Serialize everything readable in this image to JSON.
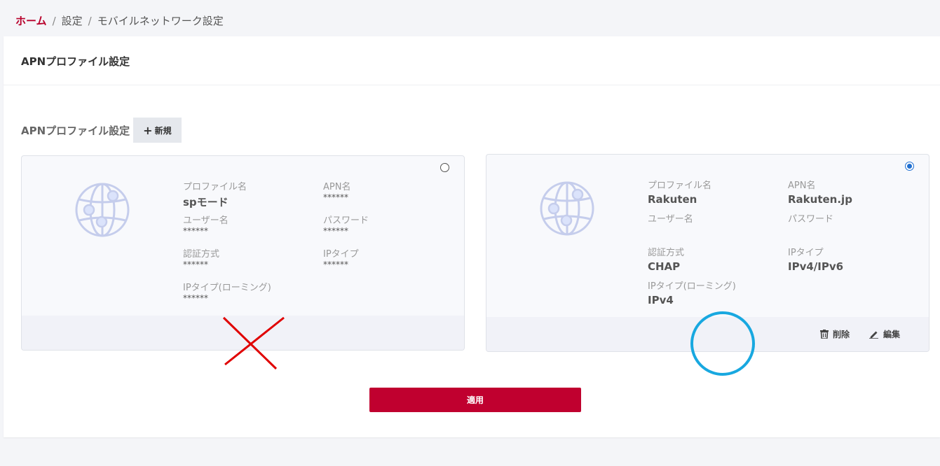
{
  "breadcrumb": {
    "home": "ホーム",
    "sep1": "/",
    "settings": "設定",
    "sep2": "/",
    "current": "モバイルネットワーク設定"
  },
  "panel": {
    "title": "APNプロファイル設定"
  },
  "section": {
    "title": "APNプロファイル設定",
    "new_plus": "+",
    "new_label": "新規"
  },
  "cards": [
    {
      "selected": false,
      "labels": {
        "profile_name": "プロファイル名",
        "apn_name": "APN名",
        "user_name": "ユーザー名",
        "password": "パスワード",
        "auth_method": "認証方式",
        "ip_type": "IPタイプ",
        "ip_type_roaming": "IPタイプ(ローミング)"
      },
      "values": {
        "profile_name": "spモード",
        "apn_name": "******",
        "user_name": "******",
        "password": "******",
        "auth_method": "******",
        "ip_type": "******",
        "ip_type_roaming": "******"
      }
    },
    {
      "selected": true,
      "labels": {
        "profile_name": "プロファイル名",
        "apn_name": "APN名",
        "user_name": "ユーザー名",
        "password": "パスワード",
        "auth_method": "認証方式",
        "ip_type": "IPタイプ",
        "ip_type_roaming": "IPタイプ(ローミング)"
      },
      "values": {
        "profile_name": "Rakuten",
        "apn_name": "Rakuten.jp",
        "auth_method": "CHAP",
        "ip_type": "IPv4/IPv6",
        "ip_type_roaming": "IPv4"
      },
      "actions": {
        "delete": "削除",
        "edit": "編集"
      }
    }
  ],
  "apply": {
    "label": "適用"
  },
  "colors": {
    "brand": "#b8002b",
    "apply": "#c0002f",
    "radio_selected": "#1f6fd1",
    "globe": "#c5cdec",
    "overlay_cross": "#e00000",
    "overlay_circle": "#18a8e0"
  },
  "icons": [
    "globe-icon",
    "trash-icon",
    "pencil-icon",
    "plus-icon"
  ]
}
